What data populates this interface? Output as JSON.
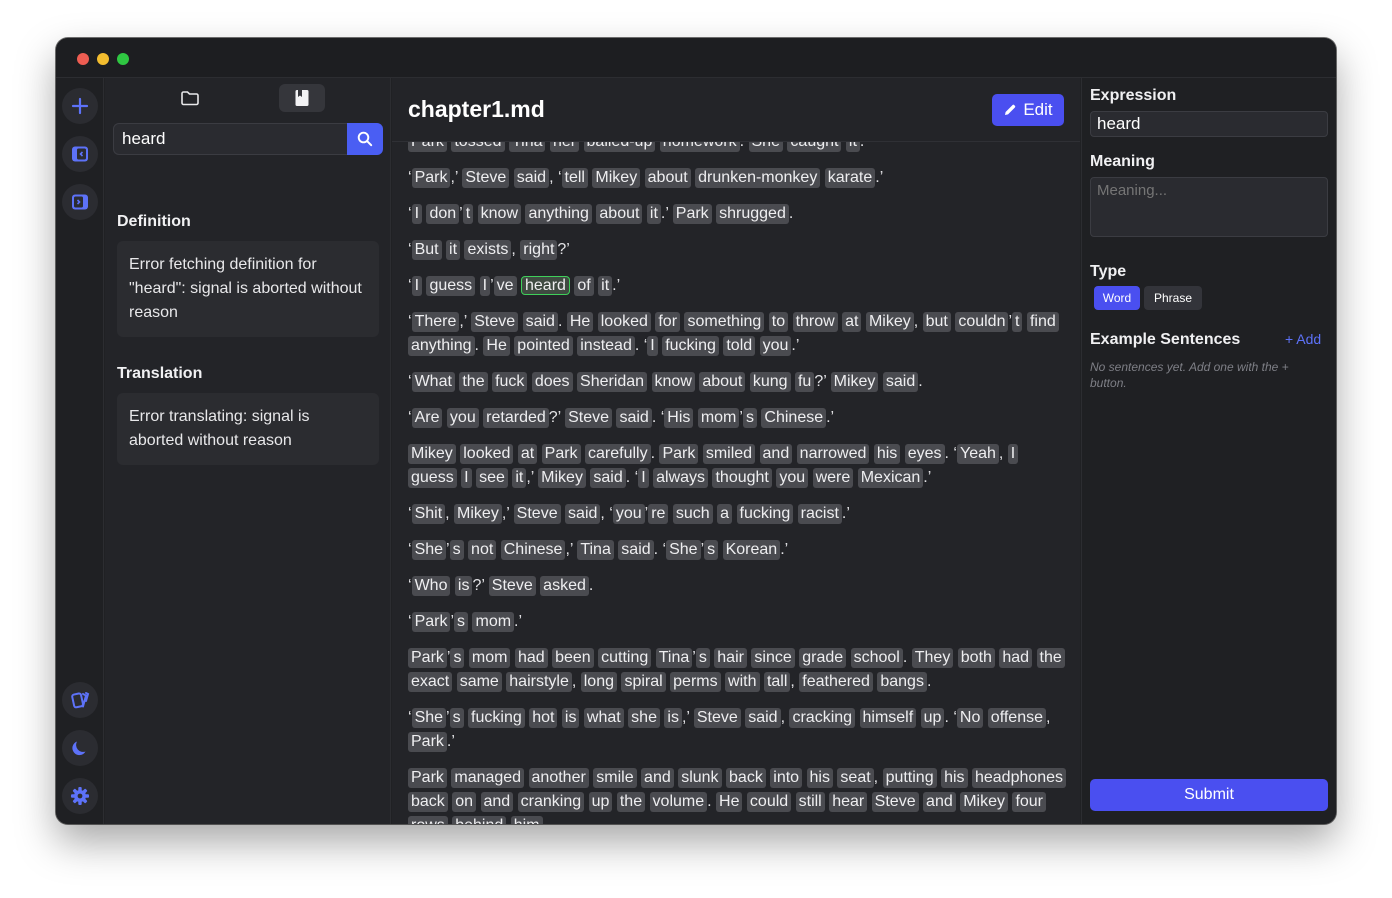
{
  "window": {
    "controls": [
      "close",
      "minimize",
      "zoom"
    ]
  },
  "rail": {
    "top_icons": [
      "plus-icon",
      "sidebar-left-icon",
      "sidebar-right-icon"
    ],
    "bottom_icons": [
      "cards-icon",
      "moon-icon",
      "gear-icon"
    ],
    "accent": "#5d72f8"
  },
  "panel": {
    "tabs": [
      "folder-icon",
      "book-icon"
    ],
    "search": {
      "value": "heard"
    },
    "definition": {
      "heading": "Definition",
      "text": "Error fetching definition for \"heard\": signal is aborted without reason"
    },
    "translation": {
      "heading": "Translation",
      "text": "Error translating: signal is aborted without reason"
    }
  },
  "main": {
    "title": "chapter1.md",
    "edit_label": "Edit",
    "highlight_word": "heard",
    "paragraphs": [
      "Park tossed Tina her balled-up homework. She caught it.",
      "‘Park,’ Steve said, ‘tell Mikey about drunken-monkey karate.’",
      "‘I don’t know anything about it.’ Park shrugged.",
      "‘But it exists, right?’",
      "‘I guess I’ve heard of it.’",
      "‘There,’ Steve said. He looked for something to throw at Mikey, but couldn’t find anything. He pointed instead. ‘I fucking told you.’",
      "‘What the fuck does Sheridan know about kung fu?’ Mikey said.",
      "‘Are you retarded?’ Steve said. ‘His mom’s Chinese.’",
      "Mikey looked at Park carefully. Park smiled and narrowed his eyes. ‘Yeah, I guess I see it,’ Mikey said. ‘I always thought you were Mexican.’",
      "‘Shit, Mikey,’ Steve said, ‘you’re such a fucking racist.’",
      "‘She’s not Chinese,’ Tina said. ‘She’s Korean.’",
      "‘Who is?’ Steve asked.",
      "‘Park’s mom.’",
      "Park’s mom had been cutting Tina’s hair since grade school. They both had the exact same hairstyle, long spiral perms with tall, feathered bangs.",
      "‘She’s fucking hot is what she is,’ Steve said, cracking himself up. ‘No offense, Park.’",
      "Park managed another smile and slunk back into his seat, putting his headphones back on and cranking up the volume. He could still hear Steve and Mikey four rows behind him."
    ]
  },
  "right": {
    "expression_label": "Expression",
    "expression_value": "heard",
    "meaning_label": "Meaning",
    "meaning_placeholder": "Meaning...",
    "type_label": "Type",
    "type_word": "Word",
    "type_phrase": "Phrase",
    "examples_label": "Example Sentences",
    "add_label": "+ Add",
    "empty_note": "No sentences yet. Add one with the + button.",
    "submit_label": "Submit"
  }
}
